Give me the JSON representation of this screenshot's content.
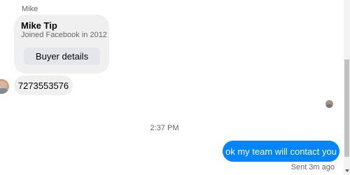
{
  "sender": {
    "name": "Mike"
  },
  "profile_card": {
    "name": "Mike Tip",
    "subtitle": "Joined Facebook in 2012",
    "button_label": "Buyer details"
  },
  "messages": [
    {
      "direction": "incoming",
      "text": "7273553576"
    },
    {
      "direction": "outgoing",
      "text": "ok my team will contact you"
    }
  ],
  "timestamp": "2:37 PM",
  "sent_status": "Sent 3m ago",
  "colors": {
    "outgoing_bubble": "#0084ff",
    "incoming_bubble": "#f0f0f0",
    "secondary_text": "#65676b"
  }
}
